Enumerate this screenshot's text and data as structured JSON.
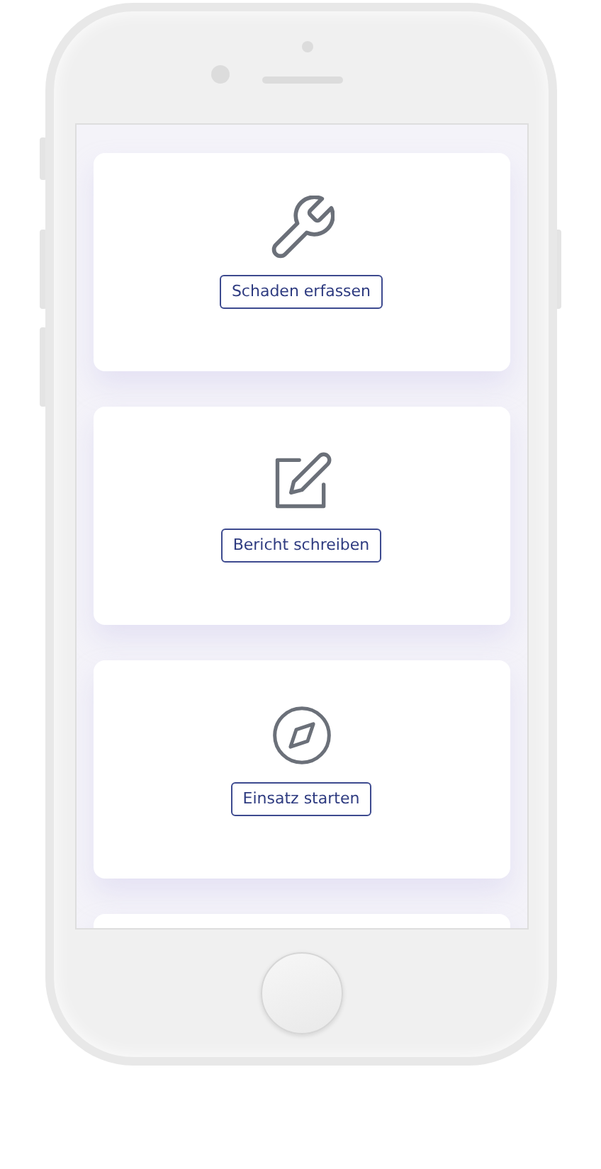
{
  "cards": [
    {
      "kind": "wrench",
      "label": "Schaden erfassen"
    },
    {
      "kind": "edit",
      "label": "Bericht schreiben"
    },
    {
      "kind": "compass",
      "label": "Einsatz starten"
    }
  ],
  "peek_card": true
}
